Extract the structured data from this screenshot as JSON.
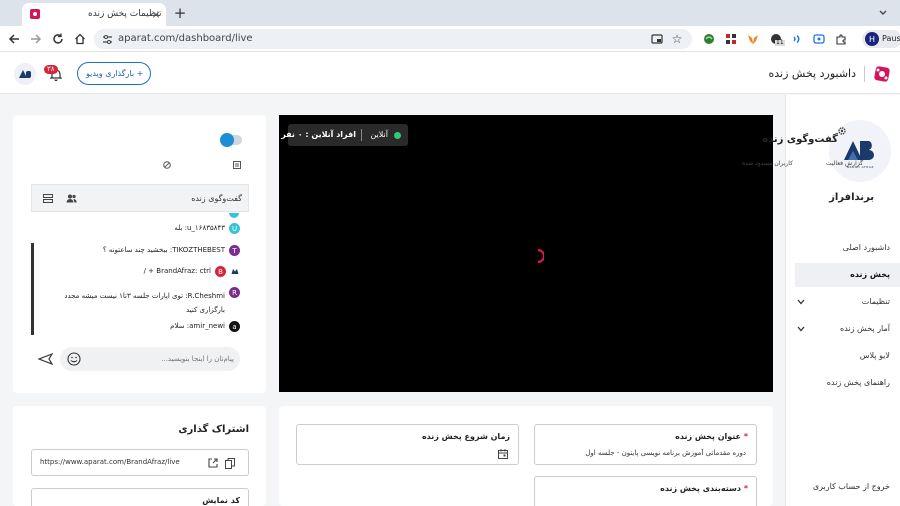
{
  "browser": {
    "tab_title": "تنظیمات پخش زنده",
    "url": "aparat.com/dashboard/live",
    "profile_label": "Paus",
    "profile_initial": "H",
    "ext_badge": "11"
  },
  "header": {
    "title": "داشبورد پخش زنده",
    "upload_button": "+ بارگذاری ویدیو",
    "notif_count": "۳۸"
  },
  "sidebar": {
    "channel_name": "برندافراز",
    "logo_text": "BRAND AFRAZ",
    "items": [
      {
        "label": "داشبورد اصلی"
      },
      {
        "label": "پخش زنده"
      },
      {
        "label": "تنظیمات"
      },
      {
        "label": "آمار پخش زنده"
      },
      {
        "label": "لایو پلاس"
      },
      {
        "label": "راهنمای پخش زنده"
      }
    ],
    "logout": "خروج از حساب کاربری"
  },
  "player": {
    "status_online": "آنلاین",
    "viewers_label": "افراد آنلاین : ۰ نفر"
  },
  "chat": {
    "title": "گفت‌وگوی زنده",
    "activity_report": "گزارش فعالیت",
    "blocked_users": "کاربران مسدود شده",
    "panel_title": "گفت‌وگوی زنده",
    "messages": [
      {
        "user": "u_۱۶۸۳۵۸۴۳",
        "text": "بله",
        "avatar": "U",
        "color": "#38c3d6"
      },
      {
        "user": "TIKOZTHEBEST",
        "text": "ببخشید چند ساعتونه ؟",
        "avatar": "T",
        "color": "#7b2c8f"
      },
      {
        "user": "BrandAfraz",
        "text": "ctrl + /",
        "avatar": "B",
        "color": "#d6243a"
      },
      {
        "user": "R.Cheshmi",
        "text": "توی اپارات جلسه ۳تا۱ نیست میشه مجدد بارگزاری کنید",
        "avatar": "R",
        "color": "#7b2c8f"
      },
      {
        "user": "amir_newi",
        "text": "سلام",
        "avatar": "a",
        "color": "#111111"
      }
    ],
    "input_placeholder": "پیام‌تان را اینجا بنویسید..."
  },
  "share": {
    "title": "اشتراک گذاری",
    "link": "https://www.aparat.com/BrandAfraz/live",
    "embed_label": "کد نمایش"
  },
  "form": {
    "title_label": "عنوان پخش زنده",
    "title_value": "دوره مقدماتی آموزش برنامه نویسی پایتون - جلسه اول",
    "start_label": "زمان شروع پخش زنده",
    "category_label": "دسته‌بندی پخش زنده",
    "required_mark": "*"
  },
  "colors": {
    "accent": "#d4145a",
    "online": "#2ecc71",
    "toggle": "#1f8dd6",
    "active_bg": "#eef0f3"
  }
}
